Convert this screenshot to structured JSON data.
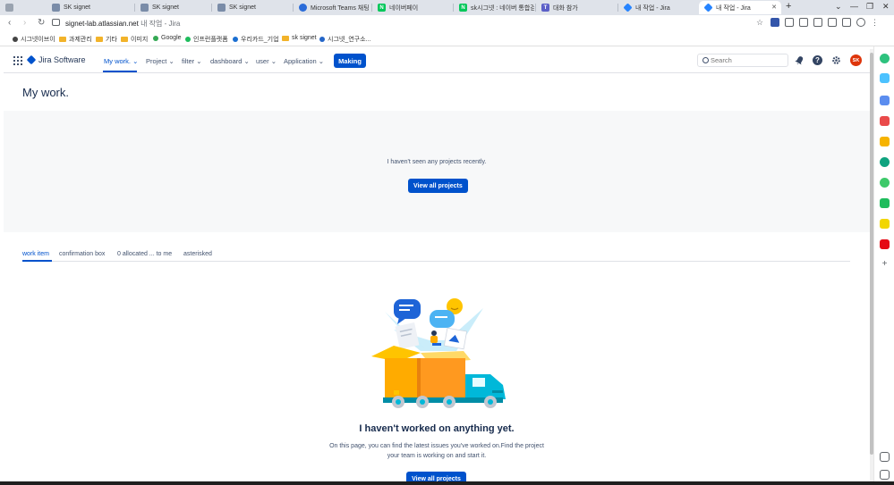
{
  "browser": {
    "tabs": [
      {
        "title": "SK signet",
        "fav_color": "#7a8ca8"
      },
      {
        "title": "SK signet",
        "fav_color": "#7a8ca8"
      },
      {
        "title": "SK signet",
        "fav_color": "#7a8ca8"
      },
      {
        "title": "Microsoft Teams 채팅 파",
        "fav_color": "#2b6cd9"
      },
      {
        "title": "네이버페이",
        "fav_color": "#03c75a"
      },
      {
        "title": "sk시그넷 : 네이버 통합검",
        "fav_color": "#03c75a"
      },
      {
        "title": "대화 참가",
        "fav_color": "#5b5fc7"
      },
      {
        "title": "내 작업 - Jira",
        "fav_color": "#2684ff"
      },
      {
        "title": "내 작업 - Jira",
        "fav_color": "#2684ff"
      }
    ],
    "new_tab_glyph": "+",
    "url_host": "signet-lab.atlassian.net",
    "url_title": "내 작업 - Jira",
    "bookmarks": [
      {
        "label": "시그넷이브이",
        "kind": "dot",
        "color": "#444"
      },
      {
        "label": "과제관리",
        "kind": "folder",
        "color": "#f2b32a"
      },
      {
        "label": "기타",
        "kind": "folder",
        "color": "#f2b32a"
      },
      {
        "label": "이미지",
        "kind": "folder",
        "color": "#f2b32a"
      },
      {
        "label": "Google",
        "kind": "dot",
        "color": "#34a853"
      },
      {
        "label": "인프런플랫폼",
        "kind": "dot",
        "color": "#1ebc5c"
      },
      {
        "label": "우리카드_기업",
        "kind": "dot",
        "color": "#1b6fd1"
      },
      {
        "label": "sk signet",
        "kind": "folder",
        "color": "#f2b32a"
      },
      {
        "label": "시그넷_연구소...",
        "kind": "dot",
        "color": "#2466c8"
      }
    ]
  },
  "jira": {
    "product_name": "Jira Software",
    "nav": [
      {
        "label": "My work.",
        "caret": "⌄",
        "active": true
      },
      {
        "label": "Project",
        "caret": "⌄",
        "active": false
      },
      {
        "label": "filter",
        "caret": "⌄",
        "active": false
      },
      {
        "label": "dashboard",
        "caret": "⌄",
        "active": false
      },
      {
        "label": "user",
        "caret": "⌄",
        "active": false
      },
      {
        "label": "Application",
        "caret": "⌄",
        "active": false
      }
    ],
    "create_label": "Making",
    "search_placeholder": "Search",
    "help_glyph": "?",
    "avatar_initials": "SK",
    "page_title": "My work.",
    "recent": {
      "message": "I haven't seen any projects recently.",
      "button": "View all projects"
    },
    "work_tabs": [
      "work item",
      "confirmation box",
      "0 allocated ... to me",
      "asterisked"
    ],
    "empty": {
      "title": "I haven't worked on anything yet.",
      "description": "On this page, you can find the latest issues you've worked on.Find the project your team is working on and start it.",
      "button": "View all projects"
    }
  },
  "colors": {
    "primary": "#0052cc",
    "panel_bg": "#f7f8f9",
    "avatar_bg": "#de350b"
  }
}
